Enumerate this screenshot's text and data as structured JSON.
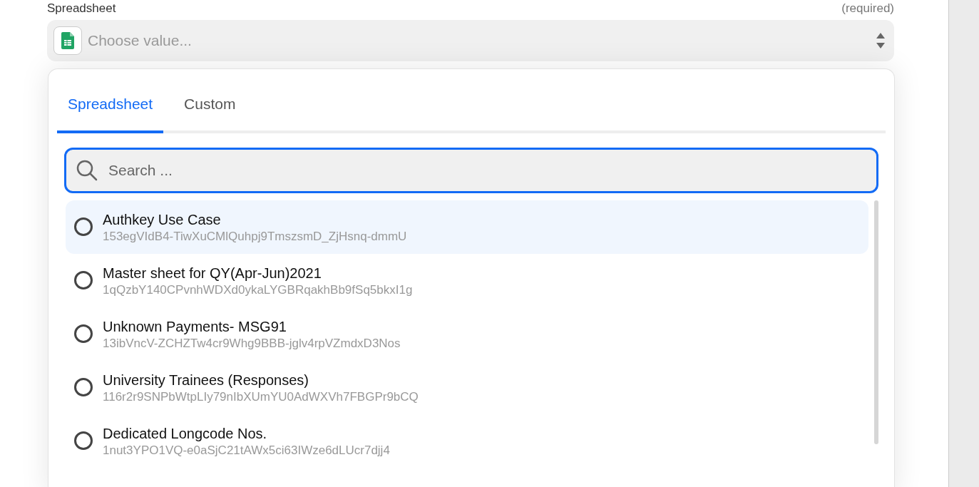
{
  "field": {
    "label": "Spreadsheet",
    "requirement": "(required)",
    "placeholder": "Choose value..."
  },
  "dropdown": {
    "tabs": [
      {
        "label": "Spreadsheet",
        "selected": true
      },
      {
        "label": "Custom",
        "selected": false
      }
    ],
    "search": {
      "placeholder": "Search ..."
    },
    "options": [
      {
        "title": "Authkey Use Case",
        "id": "153egVIdB4-TiwXuCMlQuhpj9TmszsmD_ZjHsnq-dmmU",
        "selected": false,
        "highlighted": true
      },
      {
        "title": "Master sheet for QY(Apr-Jun)2021",
        "id": "1qQzbY140CPvnhWDXd0ykaLYGBRqakhBb9fSq5bkxI1g",
        "selected": false,
        "highlighted": false
      },
      {
        "title": "Unknown Payments- MSG91",
        "id": "13ibVncV-ZCHZTw4cr9Whg9BBB-jglv4rpVZmdxD3Nos",
        "selected": false,
        "highlighted": false
      },
      {
        "title": "University Trainees (Responses)",
        "id": "116r2r9SNPbWtpLIy79nIbXUmYU0AdWXVh7FBGPr9bCQ",
        "selected": false,
        "highlighted": false
      },
      {
        "title": "Dedicated Longcode Nos.",
        "id": "1nut3YPO1VQ-e0aSjC21tAWx5ci63IWze6dLUcr7djj4",
        "selected": false,
        "highlighted": false
      }
    ]
  }
}
